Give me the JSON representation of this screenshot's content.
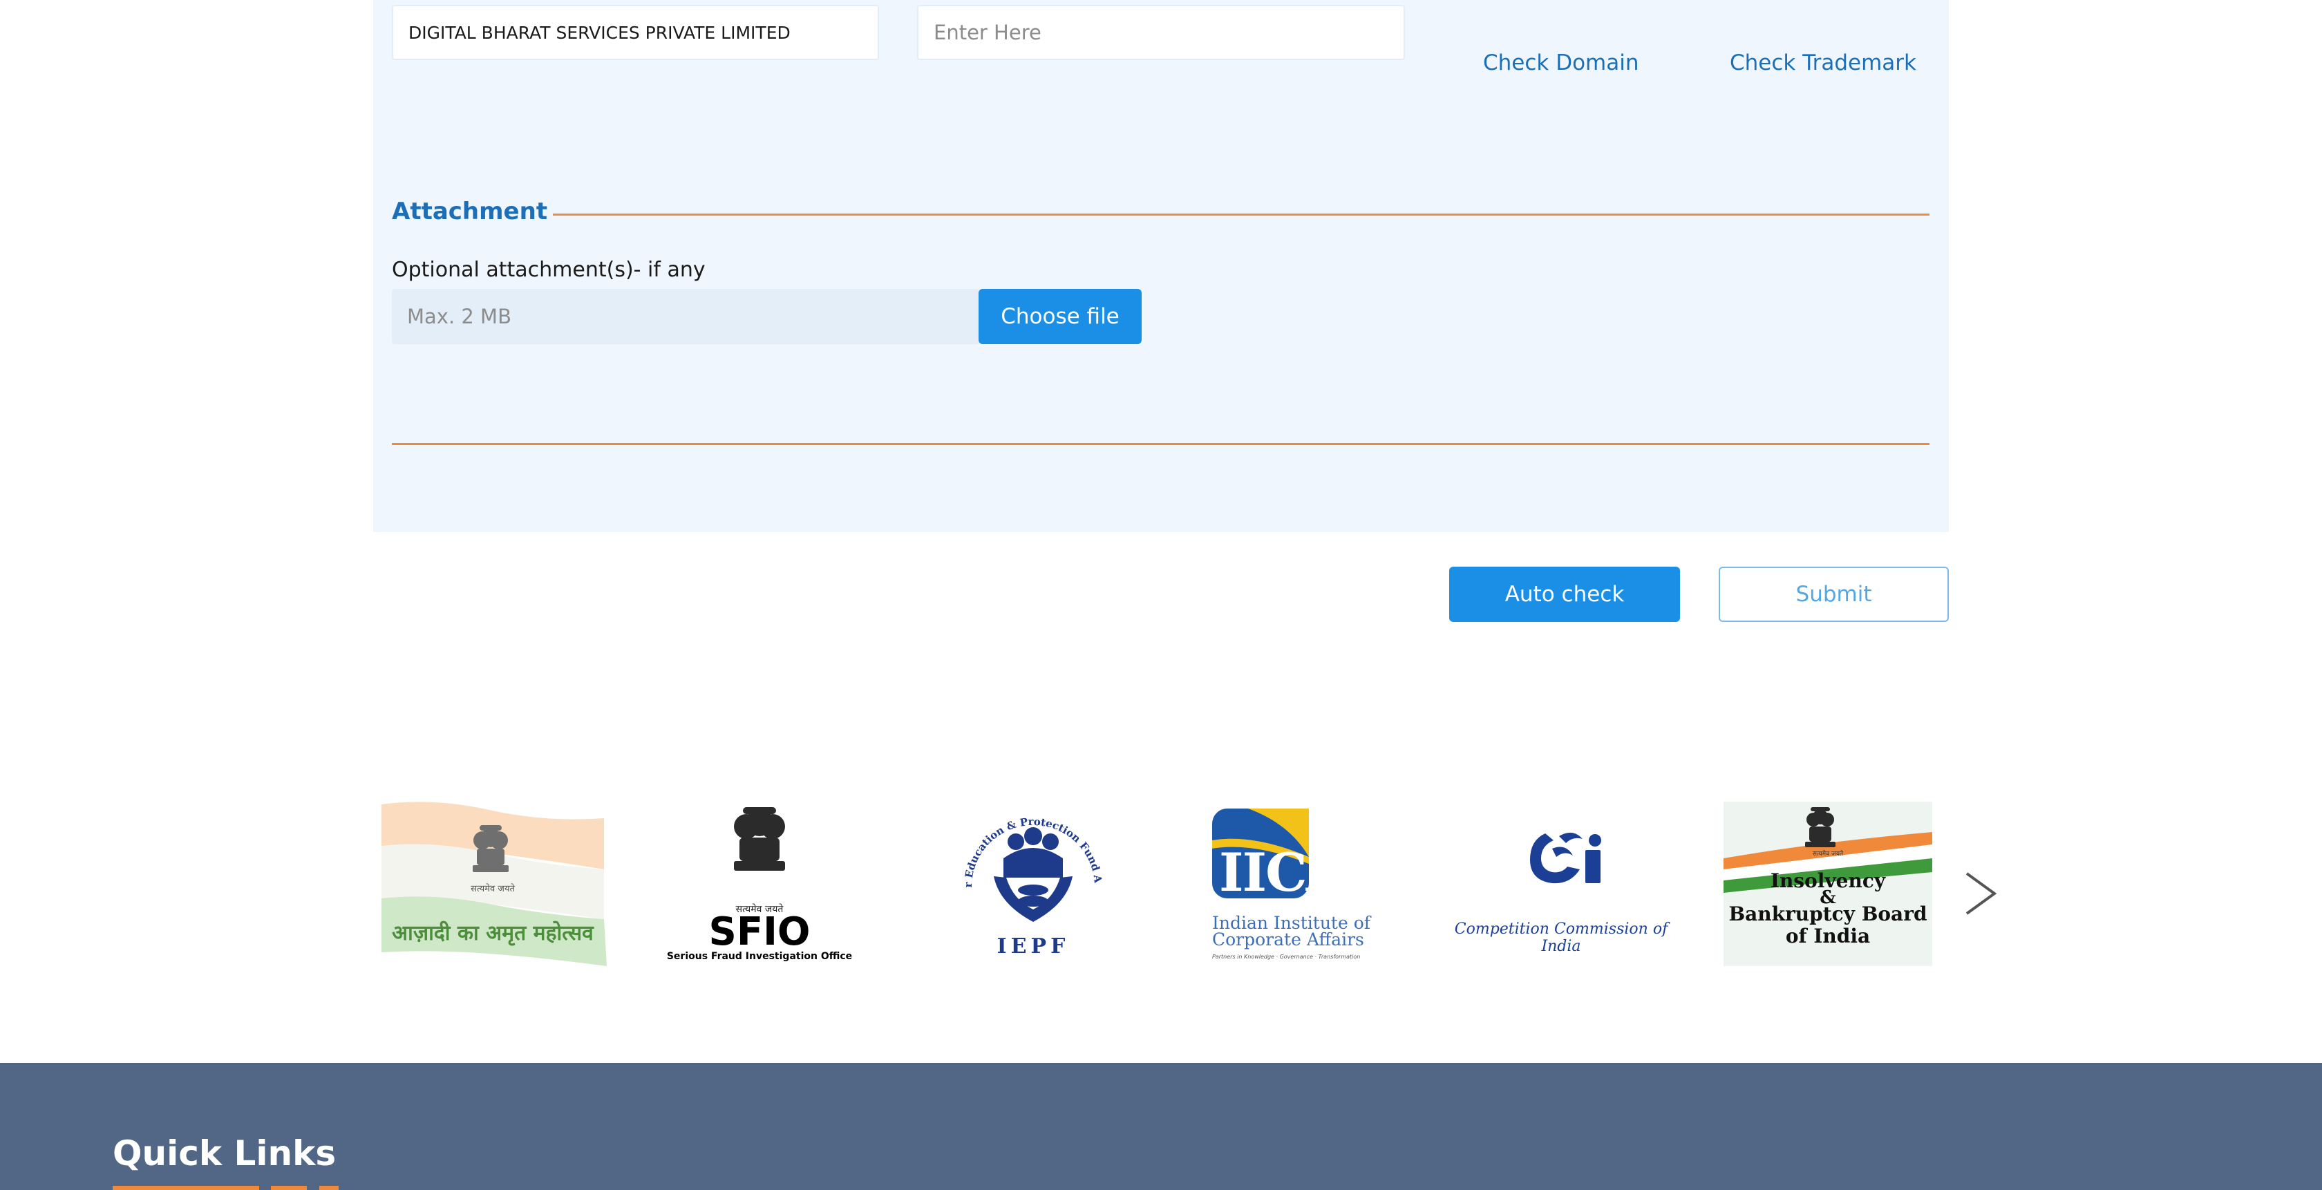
{
  "form": {
    "company_name_value": "DIGITAL BHARAT SERVICES PRIVATE LIMITED",
    "proposed_name_placeholder": "Enter Here",
    "check_domain_label": "Check Domain",
    "check_trademark_label": "Check Trademark"
  },
  "attachment": {
    "section_title": "Attachment",
    "field_label": "Optional attachment(s)- if any",
    "file_placeholder": "Max. 2 MB",
    "choose_file_label": "Choose file"
  },
  "actions": {
    "auto_check_label": "Auto check",
    "submit_label": "Submit"
  },
  "partner_logos": {
    "azadi": {
      "caption": "आज़ादी का अमृत महोत्सव",
      "emblem_motto": "सत्यमेव जयते"
    },
    "sfio": {
      "title": "SFIO",
      "subtitle": "Serious Fraud Investigation Office",
      "emblem_motto": "सत्यमेव जयते"
    },
    "iepf": {
      "ring_text": "Investor Education & Protection Fund Authority",
      "acronym": "IEPF"
    },
    "iica": {
      "acronym": "IICA",
      "name_line1": "Indian Institute of",
      "name_line2": "Corporate Affairs",
      "tagline": "Partners in Knowledge · Governance · Transformation"
    },
    "cci": {
      "name": "Competition Commission of India"
    },
    "ibbi": {
      "line1": "Insolvency",
      "line2": "&",
      "line3": "Bankruptcy Board",
      "line4": "of India",
      "emblem_motto": "सत्यमेव जयते"
    },
    "next_icon": "chevron-right-icon"
  },
  "footer": {
    "quick_links_title": "Quick Links"
  },
  "colors": {
    "accent_blue": "#1b8fe6",
    "link_blue": "#1c6fb7",
    "orange_rule": "#f0893a",
    "panel_bg": "#eff6fe",
    "footer_bg": "#526685"
  }
}
